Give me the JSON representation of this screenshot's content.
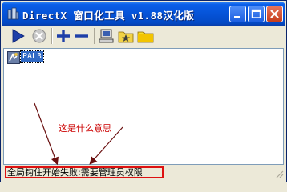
{
  "window": {
    "title": "DirectX 窗口化工具 v1.88汉化版",
    "icon": "app-building-icon",
    "controls": [
      "minimize-icon",
      "maximize-icon",
      "close-icon"
    ]
  },
  "toolbar": {
    "buttons": [
      {
        "name": "play",
        "icon": "play-icon"
      },
      {
        "name": "stop",
        "icon": "stop-icon"
      },
      {
        "name": "add",
        "icon": "plus-icon"
      },
      {
        "name": "remove",
        "icon": "minus-icon"
      },
      {
        "name": "computer",
        "icon": "computer-icon"
      },
      {
        "name": "settings-folder",
        "icon": "folder-star-icon"
      },
      {
        "name": "open-folder",
        "icon": "folder-icon"
      }
    ]
  },
  "tree": {
    "items": [
      {
        "label": "PAL3",
        "icon": "game-shortcut-icon"
      }
    ]
  },
  "annotation": {
    "text": "这是什么意思",
    "color": "#cc0000"
  },
  "status": {
    "message": "全局钩住开始失败:需要管理员权限",
    "highlight_color": "#dd1111"
  }
}
